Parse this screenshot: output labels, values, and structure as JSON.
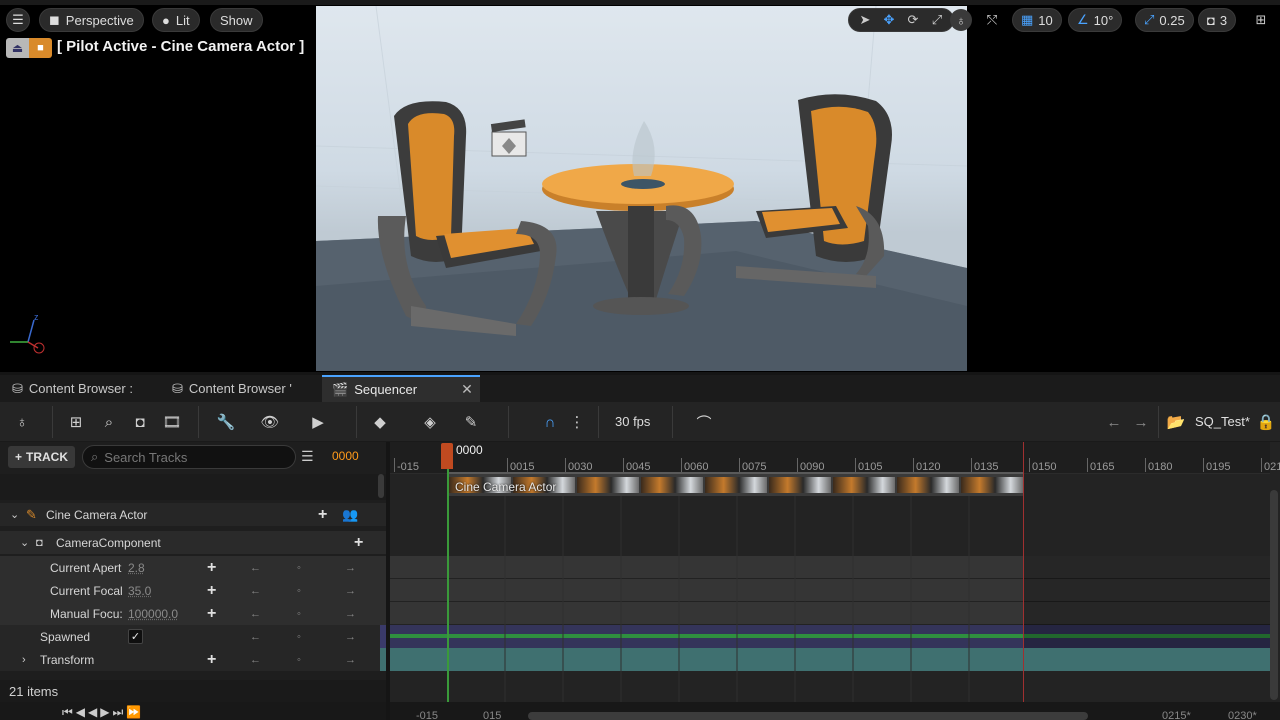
{
  "viewport": {
    "menu_icon": "hamburger-icon",
    "view_mode": "Perspective",
    "lighting_mode": "Lit",
    "show_label": "Show",
    "pilot_label": "[ Pilot Active - Cine Camera Actor ]",
    "grid_size": "10",
    "rotation_snap": "10°",
    "scale_snap": "0.25",
    "camera_speed": "3"
  },
  "tabs": [
    {
      "label": "Content Browser :"
    },
    {
      "label": "Content Browser '"
    },
    {
      "label": "Sequencer"
    }
  ],
  "seq_toolbar": {
    "fps": "30 fps",
    "sequence_name": "SQ_Test*"
  },
  "outliner": {
    "track_button": "TRACK",
    "search_placeholder": "Search Tracks",
    "current_frame": "0000",
    "rows": [
      {
        "label": "Cine Camera Actor"
      },
      {
        "label": "CameraComponent"
      },
      {
        "label": "Current Apert",
        "value": "2.8"
      },
      {
        "label": "Current Focal",
        "value": "35.0"
      },
      {
        "label": "Manual Focu:",
        "value": "100000.0"
      },
      {
        "label": "Spawned"
      },
      {
        "label": "Transform"
      }
    ],
    "item_count": "21 items"
  },
  "timeline": {
    "playhead_label": "0000",
    "ticks": [
      "-015",
      "0015",
      "0030",
      "0045",
      "0060",
      "0075",
      "0090",
      "0105",
      "0120",
      "0135",
      "0150",
      "0165",
      "0180",
      "0195",
      "021"
    ],
    "section_label": "Cine Camera Actor",
    "bottom_left_a": "-015",
    "bottom_left_b": "015",
    "bottom_right_a": "0215*",
    "bottom_right_b": "0230*"
  },
  "colors": {
    "accent_blue": "#4aa3ff",
    "frame_orange": "#ff9a1a",
    "playhead": "#c04a20",
    "end_marker": "#a03030",
    "spawned_green": "#2f8f3f",
    "transform_teal": "#3f7070"
  }
}
